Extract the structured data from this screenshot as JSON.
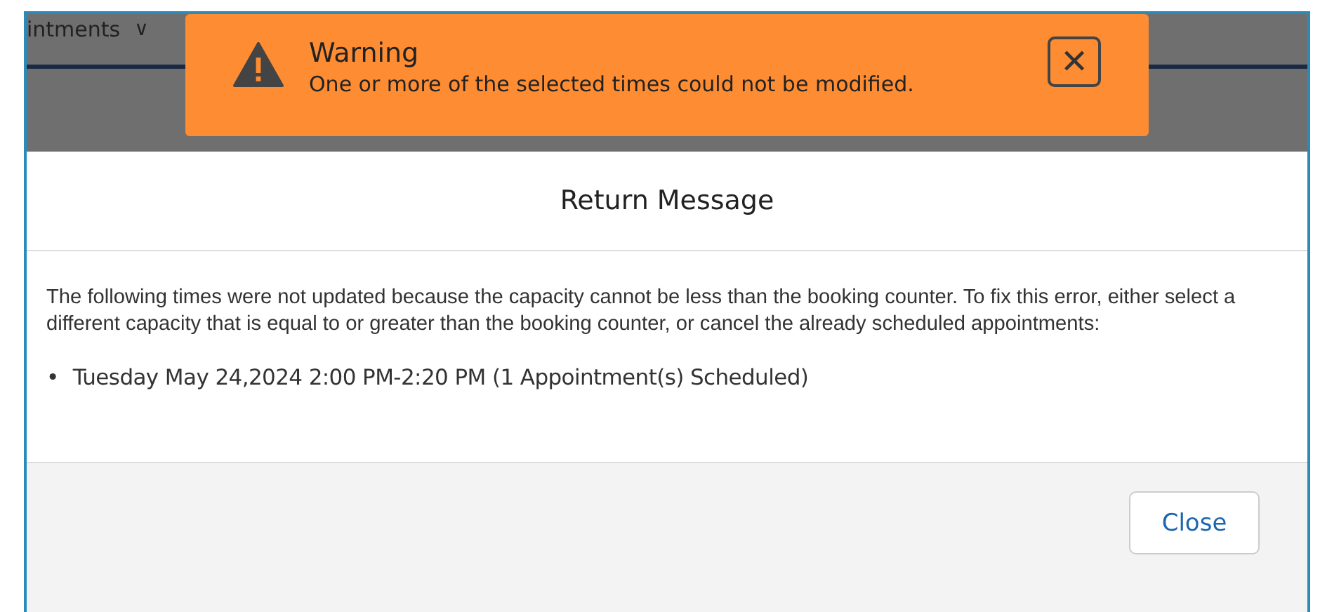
{
  "background_tab": {
    "label": "intments",
    "caret": "∨"
  },
  "toast": {
    "title": "Warning",
    "message": "One or more of the selected times could not be modified.",
    "close": "✕"
  },
  "modal": {
    "title": "Return Message",
    "body": "The following times were not updated because the capacity cannot be less than the booking counter. To fix this error, either select a different capacity that is equal to or greater than the booking counter, or cancel the already scheduled appointments:",
    "bullet": "•",
    "items": [
      "Tuesday May 24,2024 2:00 PM-2:20 PM (1 Appointment(s) Scheduled)"
    ],
    "buttons": [
      "Close"
    ]
  }
}
